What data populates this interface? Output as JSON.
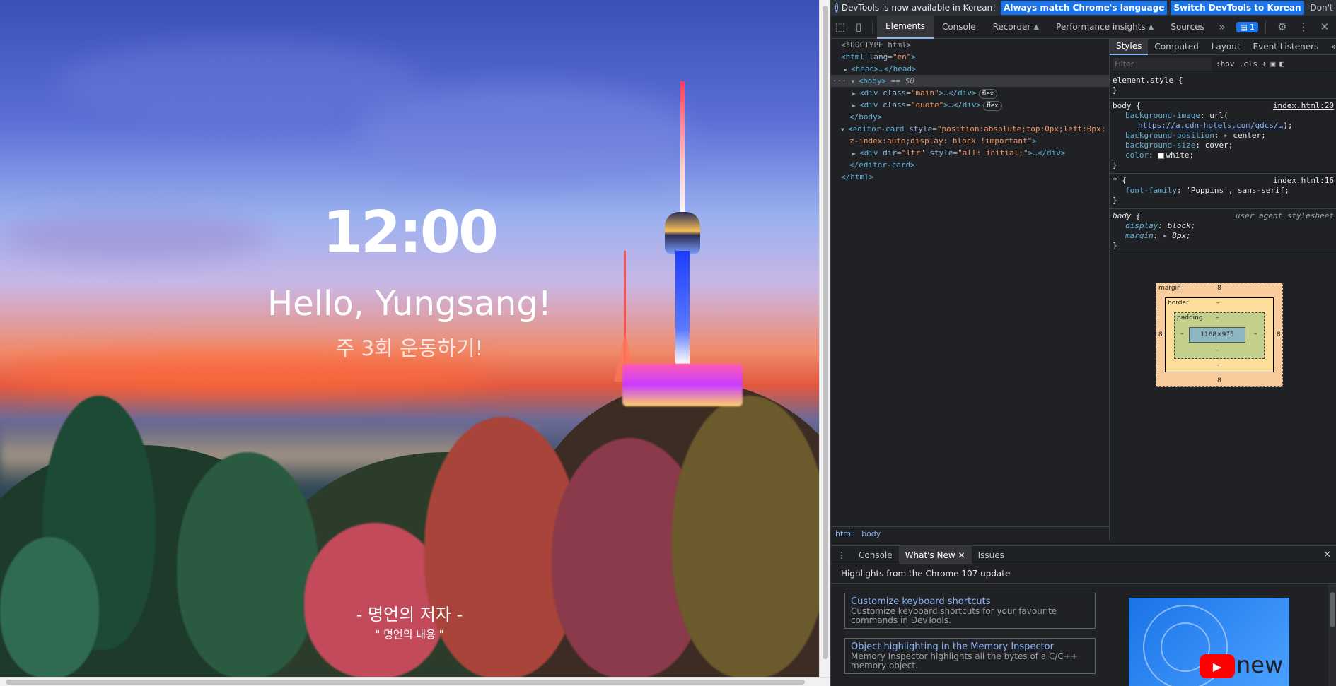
{
  "page": {
    "clock": "12:00",
    "greeting": "Hello, Yungsang!",
    "goal": "주 3회 운동하기!",
    "quote_author": "- 명언의 저자 -",
    "quote_text": "\" 명언의 내용 \""
  },
  "devtools": {
    "infobar": {
      "message": "DevTools is now available in Korean!",
      "btn_match": "Always match Chrome's language",
      "btn_switch": "Switch DevTools to Korean",
      "btn_dismiss": "Don't show again",
      "close": "✕"
    },
    "tabs": [
      {
        "label": "Elements"
      },
      {
        "label": "Console"
      },
      {
        "label": "Recorder"
      },
      {
        "label": "Performance insights"
      },
      {
        "label": "Sources"
      }
    ],
    "issues_count": "1",
    "dom": {
      "doctype": "<!DOCTYPE html>",
      "html_open_tag": "<html",
      "html_lang_attr": "lang",
      "html_lang_val": "\"en\"",
      "html_open_end": ">",
      "head": "<head>…</head>",
      "body_tag": "<body>",
      "body_eq": "== $0",
      "div_main_open": "<div",
      "div_class_attr": "class",
      "div_main_val": "\"main\"",
      "div_end": ">…</div>",
      "div_quote_val": "\"quote\"",
      "flex": "flex",
      "body_close": "</body>",
      "editor_open": "<editor-card",
      "editor_style_attr": "style",
      "editor_style_val_1": "\"position:absolute;top:0px;left:0px;",
      "editor_style_val_2": "z-index:auto;display: block !important\"",
      "editor_open_end": ">",
      "div_dir_open": "<div",
      "div_dir_attr": "dir",
      "div_dir_val": "\"ltr\"",
      "div_style_attr": "style",
      "div_style_val": "\"all: initial;\"",
      "div_dir_end": ">…</div>",
      "editor_close": "</editor-card>",
      "html_close": "</html>"
    },
    "breadcrumbs": [
      "html",
      "body"
    ],
    "styles_tabs": [
      "Styles",
      "Computed",
      "Layout",
      "Event Listeners"
    ],
    "filter_placeholder": "Filter",
    "filter_hov": ":hov",
    "filter_cls": ".cls",
    "rules": {
      "element_style": "element.style {",
      "close": "}",
      "body_sel": "body {",
      "body_src": "index.html:20",
      "bg_image_name": "background-image",
      "bg_image_val_pre": "url(",
      "bg_image_url": "https://a.cdn-hotels.com/gdcs/…",
      "bg_image_val_post": ");",
      "bg_pos_name": "background-position",
      "bg_pos_val": "center;",
      "bg_size_name": "background-size",
      "bg_size_val": "cover;",
      "color_name": "color",
      "color_val": "white;",
      "star_sel": "* {",
      "star_src": "index.html:16",
      "ff_name": "font-family",
      "ff_val": "'Poppins', sans-serif;",
      "ua_sel": "body {",
      "ua_src": "user agent stylesheet",
      "display_name": "display",
      "display_val": "block;",
      "margin_name": "margin",
      "margin_val": "8px;"
    },
    "boxmodel": {
      "margin_label": "margin",
      "margin_val": "8",
      "border_label": "border",
      "padding_label": "padding",
      "dash": "–",
      "content_size": "1168×975"
    },
    "drawer": {
      "tabs": [
        "Console",
        "What's New",
        "Issues"
      ],
      "heading": "Highlights from the Chrome 107 update",
      "cards": [
        {
          "title": "Customize keyboard shortcuts",
          "desc": "Customize keyboard shortcuts for your favourite commands in DevTools."
        },
        {
          "title": "Object highlighting in the Memory Inspector",
          "desc": "Memory Inspector highlights all the bytes of a C/C++ memory object."
        }
      ],
      "video_label": "new"
    }
  }
}
